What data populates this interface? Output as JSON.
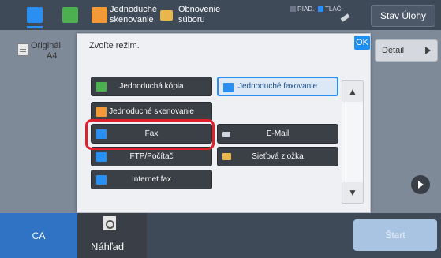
{
  "topbar": {
    "tab1_icon": "home-doc-icon",
    "tab2_icon": "copy-icon",
    "shortcut1": {
      "line1": "Jednoduché",
      "line2": "skenovanie",
      "icon": "scan-icon"
    },
    "shortcut2": {
      "line1": "Obnovenie",
      "line2": "súboru",
      "icon": "folder-icon"
    },
    "indicator1": "RIAD.",
    "indicator2": "TLAČ.",
    "job_status_label": "Stav Úlohy"
  },
  "original": {
    "label": "Originál",
    "size": "A4"
  },
  "detail_label": "Detail",
  "dialog": {
    "title": "Zvoľte režim.",
    "ok_label": "OK",
    "buttons": [
      {
        "label": "Jednoduchá kópia",
        "icon": "copy-icon"
      },
      {
        "label": "Jednoduché faxovanie",
        "icon": "fax-icon"
      },
      {
        "label": "Jednoduché skenovanie",
        "icon": "scan-icon"
      },
      {
        "label": "Fax",
        "icon": "fax-icon"
      },
      {
        "label": "E-Mail",
        "icon": "mail-icon"
      },
      {
        "label": "FTP/Počítač",
        "icon": "pc-icon"
      },
      {
        "label": "Sieťová zložka",
        "icon": "folder-icon"
      },
      {
        "label": "Internet fax",
        "icon": "internet-fax-icon"
      }
    ],
    "scroll_up_icon": "scroll-top-icon",
    "scroll_down_icon": "scroll-bottom-icon"
  },
  "bottombar": {
    "ca_label": "CA",
    "preview_label": "Náhľad",
    "start_label": "Štart"
  },
  "colors": {
    "accent": "#2a8ff2",
    "highlight_ring": "#e0202b",
    "bar": "#3f4a59"
  }
}
